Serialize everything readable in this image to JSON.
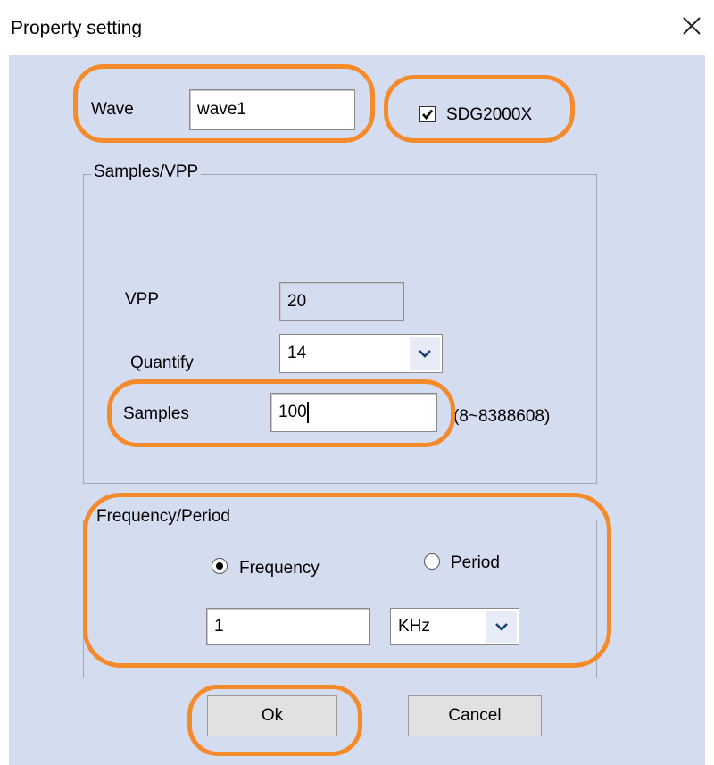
{
  "window": {
    "title": "Property setting",
    "close_icon": "close-icon"
  },
  "wave": {
    "label": "Wave",
    "value": "wave1"
  },
  "sdg_checkbox": {
    "label": "SDG2000X",
    "checked": true
  },
  "samples_group": {
    "title": "Samples/VPP",
    "vpp_label": "VPP",
    "vpp_value": "20",
    "quantify_label": "Quantify",
    "quantify_value": "14",
    "samples_label": "Samples",
    "samples_value": "100",
    "samples_range": "(8~8388608)"
  },
  "freq_group": {
    "title": "Frequency/Period",
    "frequency_label": "Frequency",
    "period_label": "Period",
    "selected": "Frequency",
    "value": "1",
    "unit": "KHz"
  },
  "buttons": {
    "ok": "Ok",
    "cancel": "Cancel"
  },
  "colors": {
    "dialog_bg": "#d4dcf0",
    "highlight": "#f58a2a"
  }
}
